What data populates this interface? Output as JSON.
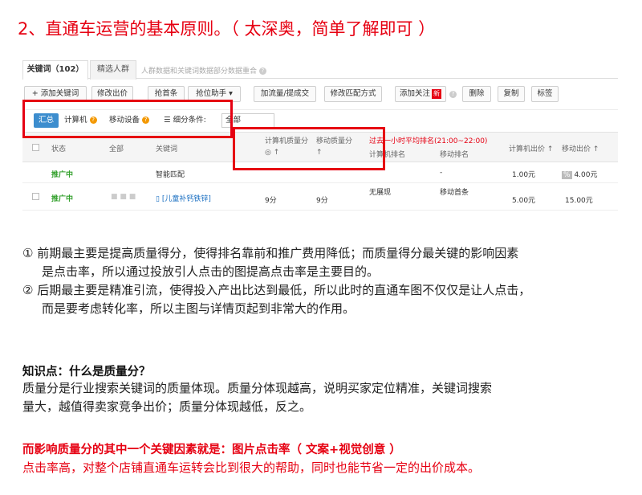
{
  "heading": "2、直通车运营的基本原则。（ 太深奥，简单了解即可 ）",
  "screenshot": {
    "tabs": [
      {
        "label": "关键词（102）"
      },
      {
        "label": "精选人群"
      }
    ],
    "tab_hint": "人群数据和关键词数据部分数据重合",
    "toolbar": [
      {
        "label": "+ 添加关键词"
      },
      {
        "label": "修改出价"
      },
      {
        "label": "抢首条"
      },
      {
        "label": "抢位助手"
      },
      {
        "label": "加流量/提成交"
      },
      {
        "label": "修改匹配方式"
      },
      {
        "label": "添加关注"
      },
      {
        "label": "删除"
      },
      {
        "label": "复制"
      },
      {
        "label": "标签"
      }
    ],
    "new_badge": "新",
    "filters": {
      "summary": "汇总",
      "computer": "计算机",
      "mobile": "移动设备",
      "segment_label": "细分条件:",
      "segment_value": "全部"
    },
    "headers": {
      "status": "状态",
      "all": "全部",
      "keyword": "关键词",
      "pc_quality": "计算机质量分",
      "mobile_quality": "移动质量分",
      "rank_title": "过去一小时平均排名(21:00~22:00)",
      "pc_rank": "计算机排名",
      "mobile_rank": "移动排名",
      "pc_bid": "计算机出价",
      "mobile_bid": "移动出价"
    },
    "rows": [
      {
        "status": "推广中",
        "keyword": "智能匹配",
        "pc_quality": "",
        "mobile_quality": "",
        "pc_rank": "",
        "mobile_rank": "-",
        "pc_bid": "1.00元",
        "mobile_bid": "4.00元"
      },
      {
        "status": "推广中",
        "keyword": "[儿童补钙铁锌]",
        "pc_quality": "9分",
        "mobile_quality": "9分",
        "pc_rank": "无展现",
        "mobile_rank": "移动首条",
        "pc_bid": "5.00元",
        "mobile_bid": "15.00元"
      }
    ]
  },
  "points": {
    "p1_line1": "① 前期最主要是提高质量得分，使得排名靠前和推广费用降低；而质量得分最关键的影响因素",
    "p1_line2": "是点击率，所以通过投放引人点击的图提高点击率是主要目的。",
    "p2_line1": "② 后期最主要是精准引流，使得投入产出比达到最低，所以此时的直通车图不仅仅是让人点击，",
    "p2_line2": "而是要考虑转化率，所以主图与详情页起到非常大的作用。"
  },
  "knowledge": {
    "title": "知识点：什么是质量分？",
    "line1": "质量分是行业搜索关键词的质量体现。质量分体现越高，说明买家定位精准，关键词搜索",
    "line2": "量大，越值得卖家竞争出价；质量分体现越低，反之。"
  },
  "factor": {
    "bold": "而影响质量分的其中一个关键因素就是：图片点击率（ 文案+视觉创意 ）",
    "text": "点击率高，对整个店铺直通车运转会比到很大的帮助，同时也能节省一定的出价成本。"
  },
  "colors": {
    "accent_red": "#e60012",
    "status_green": "#33a02c",
    "link_blue": "#1a6fc2",
    "chip_blue": "#3c8dce"
  }
}
